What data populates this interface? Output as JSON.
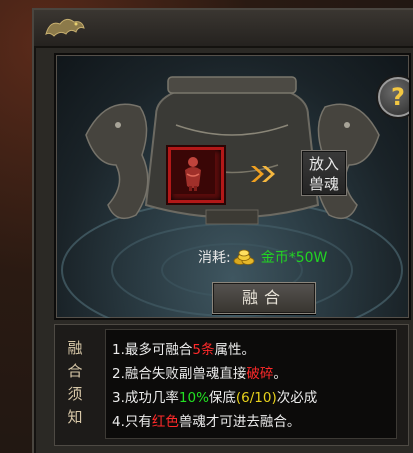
{
  "panel": {
    "help_icon": "question-mark-icon",
    "help_label": "?",
    "slot_icon": "beast-soul-item-icon",
    "put_soul_button": {
      "line1": "放入",
      "line2": "兽魂"
    },
    "cost": {
      "label": "消耗:",
      "currency_icon": "gold-coins-icon",
      "value": "金币*50W"
    },
    "fuse_button_label": "融合"
  },
  "notes": {
    "title_chars": [
      "融",
      "合",
      "须",
      "知"
    ],
    "lines": [
      {
        "a": "1.最多可融合",
        "b": "5条",
        "c": "属性。"
      },
      {
        "a": "2.融合失败副兽魂直接",
        "b": "破碎",
        "c": "。"
      },
      {
        "a": "3.成功几率",
        "b": "10%",
        "c": "保底",
        "d": "(6/10)",
        "e": "次必成"
      },
      {
        "a": "4.只有",
        "b": "红色",
        "c": "兽魂才可进去融合。"
      }
    ]
  },
  "colors": {
    "highlight_red": "#ff2a2a",
    "highlight_green": "#22e022",
    "highlight_yellow": "#e8d21c",
    "cost_green": "#22d422"
  }
}
